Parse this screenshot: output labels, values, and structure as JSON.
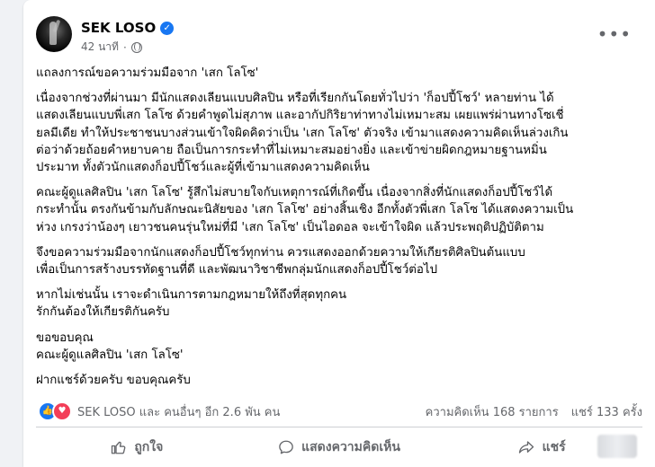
{
  "post": {
    "author": "SEK LOSO",
    "timestamp": "42 นาที",
    "paragraphs": [
      "แถลงการณ์ขอความร่วมมือจาก 'เสก โลโซ'",
      "เนื่องจากช่วงที่ผ่านมา มีนักแสดงเลียนแบบศิลปิน หรือที่เรียกกันโดยทั่วไปว่า 'ก็อปปี้โชว์' หลายท่าน ได้\nแสดงเลียนแบบพี่เสก โลโซ ด้วยคำพูดไม่สุภาพ และอากัปกิริยาท่าทางไม่เหมาะสม  เผยแพร่ผ่านทางโซเชี่\nยลมีเดีย ทำให้ประชาชนบางส่วนเข้าใจผิดคิดว่าเป็น 'เสก โลโซ' ตัวจริง เข้ามาแสดงความคิดเห็นล่วงเกิน\nต่อว่าด้วยถ้อยคำหยาบคาย ถือเป็นการกระทำที่ไม่เหมาะสมอย่างยิ่ง และเข้าข่ายผิดกฎหมายฐานหมิ่น\nประมาท ทั้งตัวนักแสดงก็อปปี้โชว์และผู้ที่เข้ามาแสดงความคิดเห็น",
      "คณะผู้ดูแลศิลปิน 'เสก โลโซ' รู้สึกไม่สบายใจกับเหตุการณ์ที่เกิดขึ้น เนื่องจากสิ่งที่นักแสดงก็อปปี้โชว์ได้\nกระทำนั้น ตรงกันข้ามกับลักษณะนิสัยของ 'เสก โลโซ' อย่างสิ้นเชิง อีกทั้งตัวพี่เสก โลโซ ได้แสดงความเป็น\nห่วง เกรงว่าน้องๆ เยาวชนคนรุ่นใหม่ที่มี 'เสก โลโซ' เป็นไอดอล จะเข้าใจผิด แล้วประพฤติปฏิบัติตาม",
      "จึงขอความร่วมมือจากนักแสดงก็อปปี้โชว์ทุกท่าน ควรแสดงออกด้วยความให้เกียรติศิลปินต้นแบบ\nเพื่อเป็นการสร้างบรรทัดฐานที่ดี และพัฒนาวิชาชีพกลุ่มนักแสดงก็อปปี้โชว์ต่อไป",
      "หากไม่เช่นนั้น เราจะดำเนินการตามกฎหมายให้ถึงที่สุดทุกคน\nรักกันต้องให้เกียรติกันครับ",
      "ขอขอบคุณ\nคณะผู้ดูแลศิลปิน 'เสก โลโซ'",
      "ฝากแชร์ด้วยครับ ขอบคุณครับ"
    ]
  },
  "stats": {
    "reactions_text": "SEK LOSO และ คนอื่นๆ อีก 2.6 พัน คน",
    "comments_text": "ความคิดเห็น 168 รายการ",
    "shares_text": "แชร์ 133 ครั้ง"
  },
  "actions": {
    "like_label": "ถูกใจ",
    "comment_label": "แสดงความคิดเห็น",
    "share_label": "แชร์"
  },
  "icons": {
    "verified": "verified-badge-icon",
    "privacy": "globe-icon",
    "more": "more-options-icon",
    "like_reaction": "like-reaction-icon",
    "love_reaction": "love-reaction-icon",
    "like_action": "thumbs-up-icon",
    "comment_action": "comment-bubble-icon",
    "share_action": "share-arrow-icon"
  },
  "colors": {
    "brand_blue": "#1877f2",
    "love_red": "#f33e58",
    "secondary_text": "#65676b",
    "background": "#f0f2f5"
  }
}
